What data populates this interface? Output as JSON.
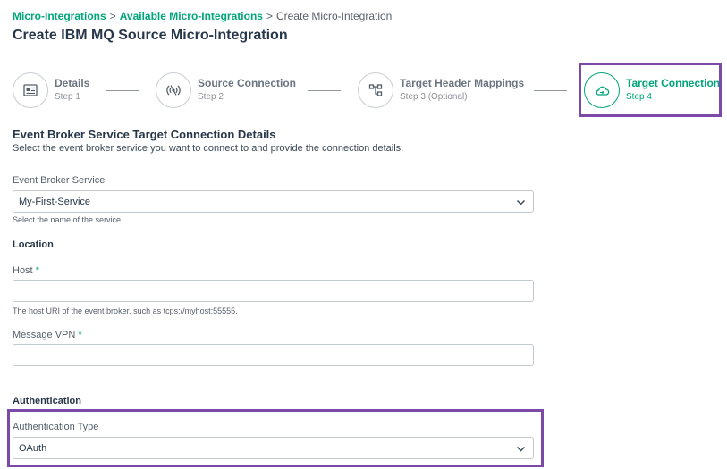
{
  "breadcrumb": {
    "items": [
      "Micro-Integrations",
      "Available Micro-Integrations"
    ],
    "current": "Create Micro-Integration",
    "separator": ">"
  },
  "page_title": "Create IBM MQ Source Micro-Integration",
  "steps": [
    {
      "label": "Details",
      "sub": "Step 1",
      "icon": "details-icon"
    },
    {
      "label": "Source Connection",
      "sub": "Step 2",
      "icon": "connection-icon"
    },
    {
      "label": "Target Header Mappings",
      "sub": "Step 3 (Optional)",
      "icon": "mapping-icon"
    },
    {
      "label": "Target Connection",
      "sub": "Step 4",
      "icon": "cloud-icon",
      "active": true
    }
  ],
  "section": {
    "title": "Event Broker Service Target Connection Details",
    "description": "Select the event broker service you want to connect to and provide the connection details."
  },
  "event_broker": {
    "label": "Event Broker Service",
    "value": "My-First-Service",
    "helper": "Select the name of the service."
  },
  "location": {
    "title": "Location",
    "host_label": "Host",
    "host_value": "",
    "host_helper": "The host URI of the event broker, such as tcps://myhost:55555.",
    "vpn_label": "Message VPN",
    "vpn_value": ""
  },
  "required_marker": "*",
  "authentication": {
    "title": "Authentication",
    "type_label": "Authentication Type",
    "type_value": "OAuth"
  },
  "colors": {
    "accent": "#00a57a",
    "highlight": "#7b4aa8",
    "text": "#273749"
  }
}
